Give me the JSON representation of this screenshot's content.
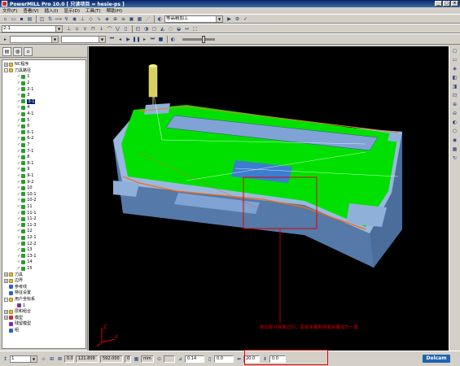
{
  "window": {
    "title": "PowerMILL Pro 10.0    [ 只读项目 = hesie-ps ]"
  },
  "menu": [
    "文件(F)",
    "查看(V)",
    "插入(I)",
    "显示(D)",
    "工具(T)",
    "帮助(H)"
  ],
  "toolbar1": {
    "combo_strategy": "等高精加工"
  },
  "toolbar2": {
    "combo_tool": "2-1"
  },
  "tree": {
    "items": [
      {
        "label": "NC程序",
        "level": 0,
        "icon": "folder",
        "expand": "+"
      },
      {
        "label": "刀具路径",
        "level": 0,
        "icon": "folder",
        "expand": "-"
      },
      {
        "label": "1",
        "level": 1,
        "icon": "green"
      },
      {
        "label": "2",
        "level": 1,
        "icon": "green"
      },
      {
        "label": "2-1",
        "level": 1,
        "icon": "green"
      },
      {
        "label": "3",
        "level": 1,
        "icon": "green"
      },
      {
        "label": "3-1",
        "level": 1,
        "icon": "green",
        "selected": true
      },
      {
        "label": "4",
        "level": 1,
        "icon": "green"
      },
      {
        "label": "4-1",
        "level": 1,
        "icon": "green"
      },
      {
        "label": "5",
        "level": 1,
        "icon": "green"
      },
      {
        "label": "6",
        "level": 1,
        "icon": "green"
      },
      {
        "label": "6-1",
        "level": 1,
        "icon": "green"
      },
      {
        "label": "6-2",
        "level": 1,
        "icon": "green"
      },
      {
        "label": "7",
        "level": 1,
        "icon": "green"
      },
      {
        "label": "7-1",
        "level": 1,
        "icon": "green"
      },
      {
        "label": "8",
        "level": 1,
        "icon": "green"
      },
      {
        "label": "8-1",
        "level": 1,
        "icon": "green"
      },
      {
        "label": "9",
        "level": 1,
        "icon": "green"
      },
      {
        "label": "9-1",
        "level": 1,
        "icon": "green"
      },
      {
        "label": "9-2",
        "level": 1,
        "icon": "green"
      },
      {
        "label": "10",
        "level": 1,
        "icon": "green"
      },
      {
        "label": "10-1",
        "level": 1,
        "icon": "green"
      },
      {
        "label": "10-2",
        "level": 1,
        "icon": "green"
      },
      {
        "label": "11",
        "level": 1,
        "icon": "green"
      },
      {
        "label": "11-1",
        "level": 1,
        "icon": "green"
      },
      {
        "label": "11-2",
        "level": 1,
        "icon": "green"
      },
      {
        "label": "11-3",
        "level": 1,
        "icon": "green"
      },
      {
        "label": "12",
        "level": 1,
        "icon": "green"
      },
      {
        "label": "12-1",
        "level": 1,
        "icon": "green"
      },
      {
        "label": "12-2",
        "level": 1,
        "icon": "green"
      },
      {
        "label": "13",
        "level": 1,
        "icon": "green"
      },
      {
        "label": "13-1",
        "level": 1,
        "icon": "green"
      },
      {
        "label": "14",
        "level": 1,
        "icon": "green"
      },
      {
        "label": "15",
        "level": 1,
        "icon": "green"
      },
      {
        "label": "刀具",
        "level": 0,
        "icon": "folder",
        "expand": "+"
      },
      {
        "label": "边界",
        "level": 0,
        "icon": "folder",
        "expand": "+"
      },
      {
        "label": "参考线",
        "level": 0,
        "icon": "blue"
      },
      {
        "label": "特征设置",
        "level": 0,
        "icon": "blue"
      },
      {
        "label": "用户坐标系",
        "level": 0,
        "icon": "folder",
        "expand": "-"
      },
      {
        "label": "1",
        "level": 1,
        "icon": "purple"
      },
      {
        "label": "层和组合",
        "level": 0,
        "icon": "folder",
        "expand": "+"
      },
      {
        "label": "模型",
        "level": 0,
        "icon": "red",
        "expand": "+"
      },
      {
        "label": "残留模型",
        "level": 0,
        "icon": "purple"
      },
      {
        "label": "组",
        "level": 0,
        "icon": "blue"
      }
    ]
  },
  "viewport": {
    "annotation": "部位部分容易过切，底部余量和侧面余量设为一致",
    "annotation_color": "#e00000",
    "background": "#000000",
    "toolpath_color": "#00e000",
    "part_color": "#8fb0d8"
  },
  "status": {
    "combo_value": "1",
    "field_a": "0.0",
    "coord_x": "121.809",
    "coord_y": "592.000",
    "coord_z": "0",
    "unit": "mm",
    "tolerance": "0.14",
    "thickness": "0.0",
    "stepover": "20.0",
    "stepdown": "0.0",
    "brand": "Delcam"
  }
}
